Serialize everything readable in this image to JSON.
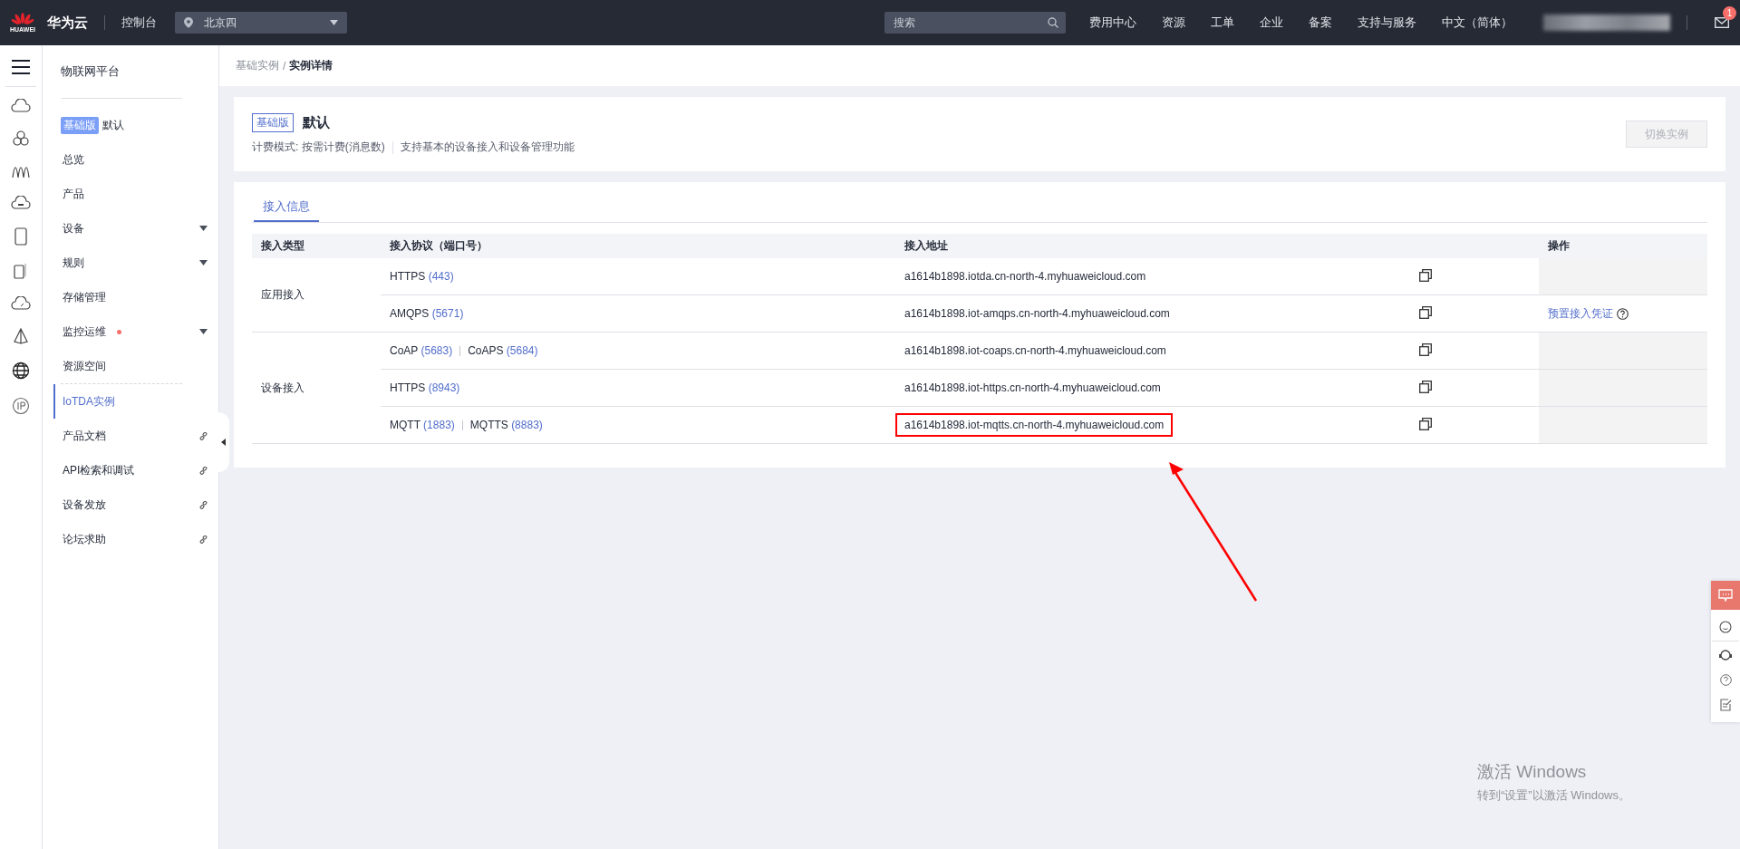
{
  "topbar": {
    "logo_text": "HUAWEI",
    "brand": "华为云",
    "console": "控制台",
    "region": "北京四",
    "search": {
      "placeholder": "搜索"
    },
    "nav": [
      "费用中心",
      "资源",
      "工单",
      "企业",
      "备案",
      "支持与服务",
      "中文（简体）"
    ],
    "mail_badge": "1"
  },
  "sidebar": {
    "title": "物联网平台",
    "edition_badge": "基础版",
    "instance": "默认",
    "items": [
      {
        "label": "总览",
        "kind": "plain",
        "selected": false
      },
      {
        "label": "产品",
        "kind": "plain",
        "selected": false
      },
      {
        "label": "设备",
        "kind": "dropdown",
        "selected": false
      },
      {
        "label": "规则",
        "kind": "dropdown",
        "selected": false
      },
      {
        "label": "存储管理",
        "kind": "plain",
        "selected": false
      },
      {
        "label": "监控运维",
        "kind": "dropdown",
        "selected": false,
        "alert": true
      },
      {
        "label": "资源空间",
        "kind": "plain",
        "selected": false
      },
      {
        "label": "IoTDA实例",
        "kind": "plain",
        "selected": true,
        "divider_before": true
      },
      {
        "label": "产品文档",
        "kind": "link",
        "selected": false
      },
      {
        "label": "API检索和调试",
        "kind": "link",
        "selected": false
      },
      {
        "label": "设备发放",
        "kind": "link",
        "selected": false
      },
      {
        "label": "论坛求助",
        "kind": "link",
        "selected": false
      }
    ]
  },
  "breadcrumb": {
    "separator": "/",
    "items": [
      "基础实例",
      "实例详情"
    ]
  },
  "instance": {
    "badge": "基础版",
    "name": "默认",
    "billing": "计费模式: 按需计费(消息数)",
    "description": "支持基本的设备接入和设备管理功能",
    "button": {
      "label": "切换实例",
      "disabled": true
    }
  },
  "tabs": [
    {
      "label": "接入信息",
      "selected": true
    }
  ],
  "table": {
    "columns": [
      "接入类型",
      "接入协议（端口号）",
      "接入地址",
      "操作"
    ],
    "groups": [
      {
        "type": "应用接入",
        "rows": [
          {
            "protocols": [
              {
                "name": "HTTPS",
                "port": "(443)"
              }
            ],
            "address": "a1614b1898.iotda.cn-north-4.myhuaweicloud.com",
            "highlighted": false
          },
          {
            "protocols": [
              {
                "name": "AMQPS",
                "port": "(5671)"
              }
            ],
            "address": "a1614b1898.iot-amqps.cn-north-4.myhuaweicloud.com",
            "highlighted": false,
            "action": "预置接入凭证"
          }
        ]
      },
      {
        "type": "设备接入",
        "rows": [
          {
            "protocols": [
              {
                "name": "CoAP",
                "port": "(5683)"
              },
              {
                "name": "CoAPS",
                "port": "(5684)"
              }
            ],
            "address": "a1614b1898.iot-coaps.cn-north-4.myhuaweicloud.com",
            "highlighted": false
          },
          {
            "protocols": [
              {
                "name": "HTTPS",
                "port": "(8943)"
              }
            ],
            "address": "a1614b1898.iot-https.cn-north-4.myhuaweicloud.com",
            "highlighted": false
          },
          {
            "protocols": [
              {
                "name": "MQTT",
                "port": "(1883)"
              },
              {
                "name": "MQTTS",
                "port": "(8883)"
              }
            ],
            "address": "a1614b1898.iot-mqtts.cn-north-4.myhuaweicloud.com",
            "highlighted": true
          }
        ]
      }
    ]
  },
  "os_notice": {
    "title": "激活 Windows",
    "text": "转到“设置”以激活 Windows。"
  }
}
